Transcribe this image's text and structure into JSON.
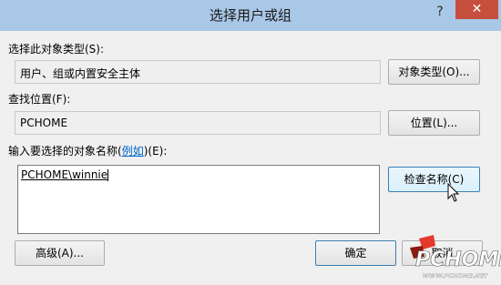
{
  "window": {
    "title": "选择用户或组",
    "help_glyph": "?",
    "close_glyph": "✕"
  },
  "object_type": {
    "label": "选择此对象类型(S):",
    "value": "用户、组或内置安全主体",
    "button_label": "对象类型(O)..."
  },
  "location": {
    "label": "查找位置(F):",
    "value": "PCHOME",
    "button_label": "位置(L)..."
  },
  "object_names": {
    "label_prefix": "输入要选择的对象名称(",
    "label_link": "例如",
    "label_suffix": ")(E):",
    "value": "PCHOME\\winnie",
    "check_names_label": "检查名称(C)"
  },
  "footer": {
    "advanced_label": "高级(A)...",
    "ok_label": "确定",
    "cancel_label": "取消"
  },
  "watermark": {
    "logo_text": "PCHOME",
    "url": "WWW.PCHOME.NET"
  }
}
